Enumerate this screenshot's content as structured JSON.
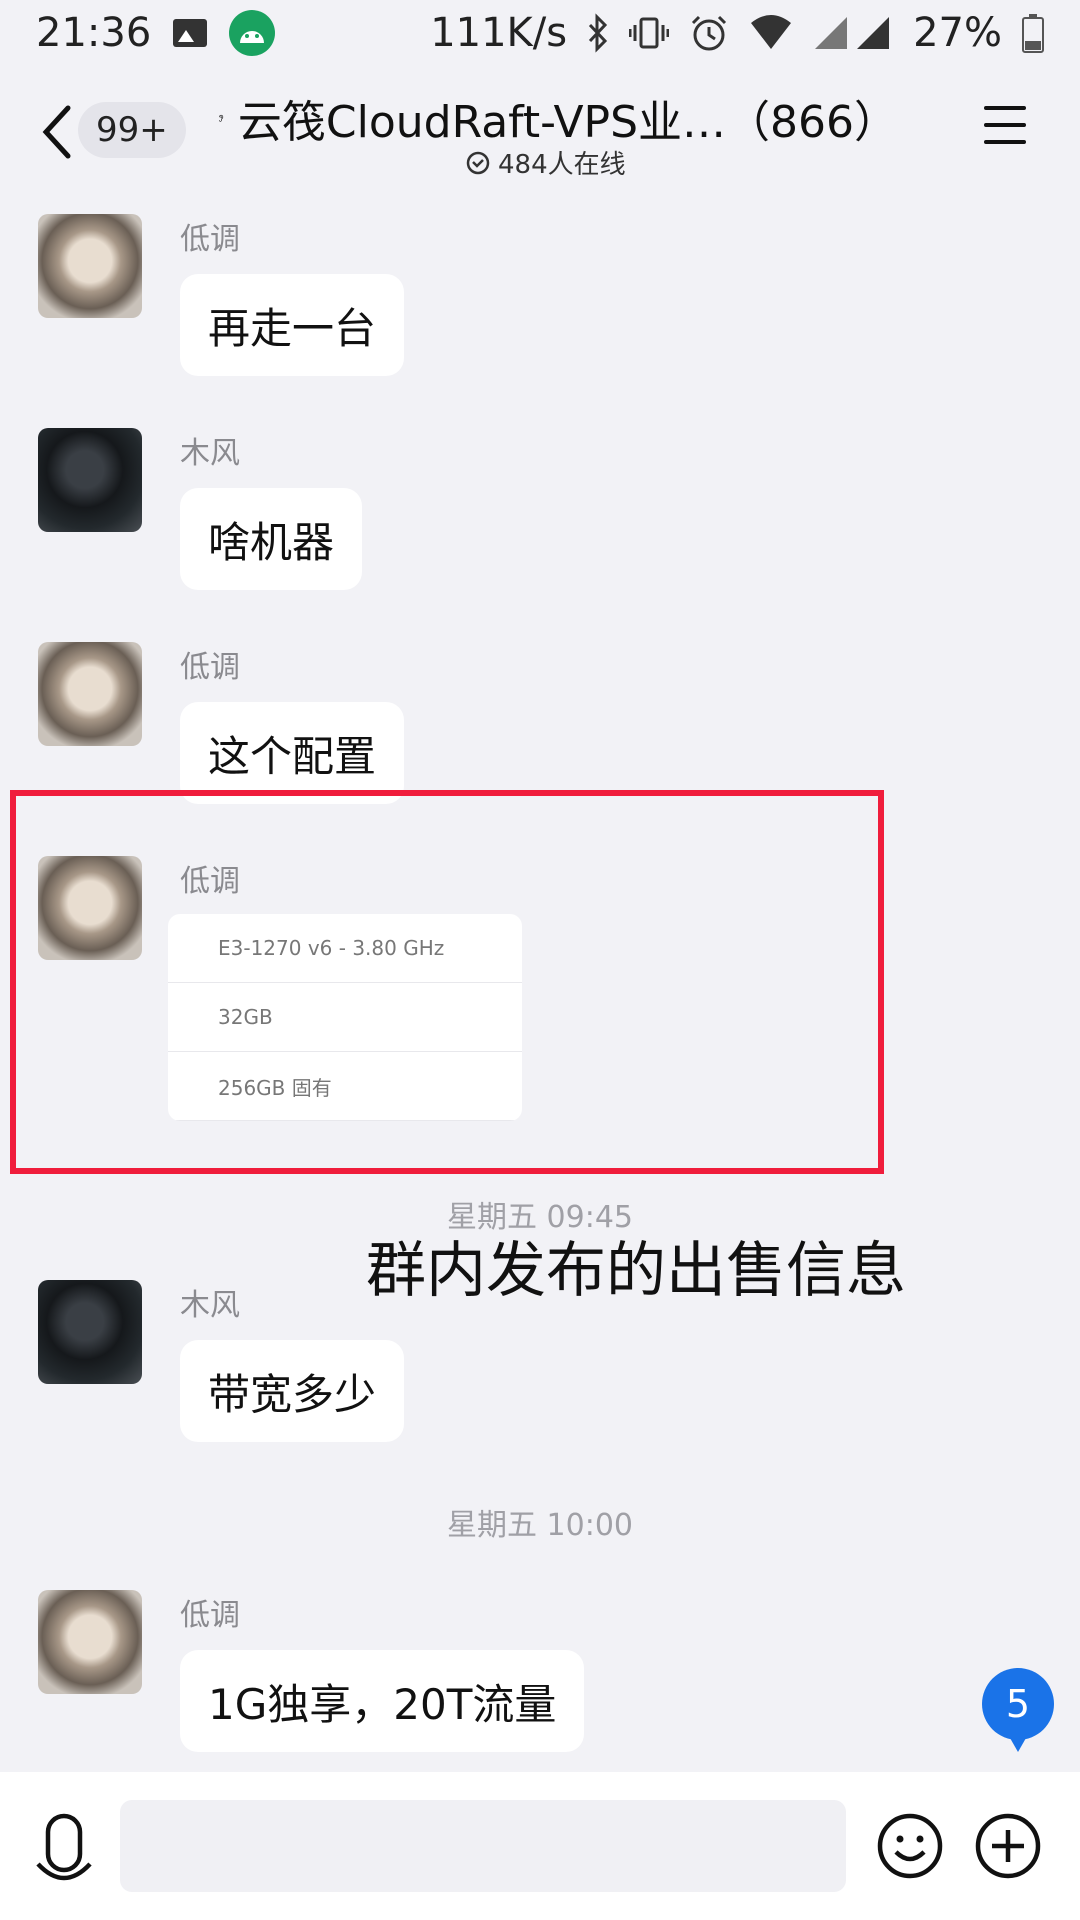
{
  "status_bar": {
    "time": "21:36",
    "network_speed": "111K/s",
    "battery": "27%",
    "icons": [
      "gallery-icon",
      "android-icon",
      "bluetooth-icon",
      "vibrate-icon",
      "alarm-icon",
      "wifi-icon",
      "signal-icon",
      "battery-icon"
    ]
  },
  "header": {
    "back_badge": "99+",
    "title": "云筏CloudRaft-VPS业…（866）",
    "online": "484人在线"
  },
  "messages": [
    {
      "sender": "低调",
      "text": "再走一台",
      "avatar": "light"
    },
    {
      "sender": "木风",
      "text": "啥机器",
      "avatar": "dark"
    },
    {
      "sender": "低调",
      "text": "这个配置",
      "avatar": "light"
    },
    {
      "sender": "低调",
      "type": "image",
      "specs": [
        "E3-1270 v6 - 3.80 GHz",
        "32GB",
        "256GB 固有"
      ],
      "avatar": "light"
    },
    {
      "sender": "木风",
      "text": "带宽多少",
      "avatar": "dark"
    },
    {
      "sender": "低调",
      "text": "1G独享，20T流量",
      "avatar": "light"
    }
  ],
  "time_labels": [
    "星期五 09:45",
    "星期五 10:00"
  ],
  "annotation": "群内发布的出售信息",
  "unread_count": "5",
  "colors": {
    "accent": "#1a73e8",
    "highlight": "#f01d3c",
    "background": "#f2f2f6"
  }
}
